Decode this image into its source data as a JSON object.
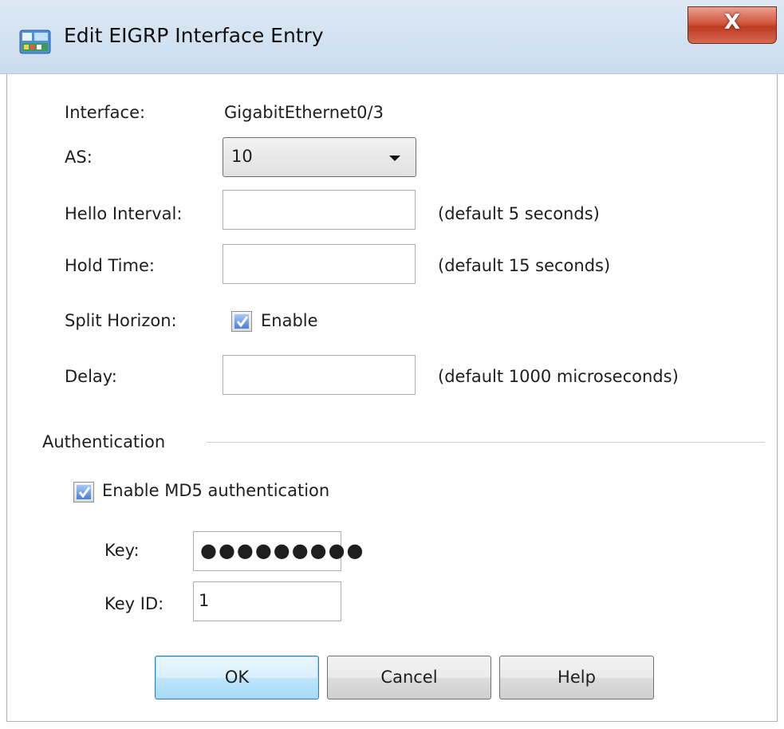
{
  "window": {
    "title": "Edit EIGRP Interface Entry",
    "close_glyph": "X",
    "icon": "network-settings-icon"
  },
  "form": {
    "interface_label": "Interface:",
    "interface_value": "GigabitEthernet0/3",
    "as_label": "AS:",
    "as_value": "10",
    "hello_label": "Hello Interval:",
    "hello_value": "",
    "hello_hint": "(default 5 seconds)",
    "hold_label": "Hold Time:",
    "hold_value": "",
    "hold_hint": "(default 15 seconds)",
    "split_label": "Split Horizon:",
    "split_checkbox_label": "Enable",
    "split_checked": true,
    "delay_label": "Delay:",
    "delay_value": "",
    "delay_hint": "(default 1000 microseconds)"
  },
  "auth": {
    "group_title": "Authentication",
    "md5_label": "Enable MD5 authentication",
    "md5_checked": true,
    "key_label": "Key:",
    "key_value": "●●●●●●●●●",
    "key_id_label": "Key ID:",
    "key_id_value": "1"
  },
  "buttons": {
    "ok": "OK",
    "cancel": "Cancel",
    "help": "Help"
  },
  "colors": {
    "titlebar": "#cbdcee",
    "close": "#c03a22",
    "checkbox_fill": "#4b7fd1",
    "default_button": "#bee6fd"
  }
}
